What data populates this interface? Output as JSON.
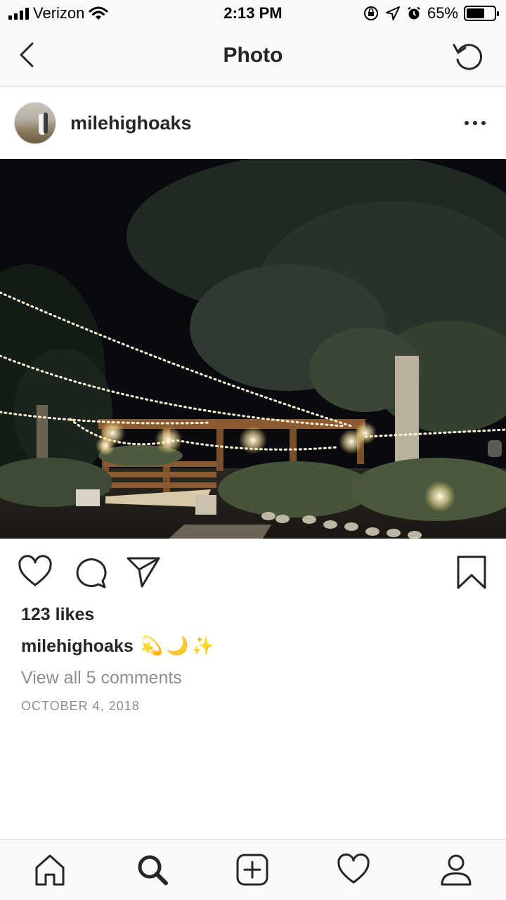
{
  "status_bar": {
    "carrier": "Verizon",
    "time": "2:13 PM",
    "battery_text": "65%",
    "battery_level": 0.65,
    "icons": [
      "signal-icon",
      "wifi-icon",
      "orientation-lock-icon",
      "location-icon",
      "alarm-icon",
      "battery-icon"
    ]
  },
  "nav": {
    "title": "Photo",
    "back_icon": "chevron-left-icon",
    "refresh_icon": "refresh-icon"
  },
  "post": {
    "username": "milehighoaks",
    "more_icon": "more-horizontal-icon",
    "photo_description_icon": "photo",
    "likes": "123 likes",
    "caption_user": "milehighoaks",
    "caption_text": "💫🌙✨",
    "view_comments": "View all 5 comments",
    "date": "OCTOBER 4, 2018"
  },
  "actions": {
    "icons": [
      "heart-icon",
      "comment-icon",
      "share-icon",
      "bookmark-icon"
    ]
  },
  "tab_bar": {
    "icons": [
      "home-icon",
      "search-icon",
      "add-post-icon",
      "activity-heart-icon",
      "profile-icon"
    ]
  }
}
